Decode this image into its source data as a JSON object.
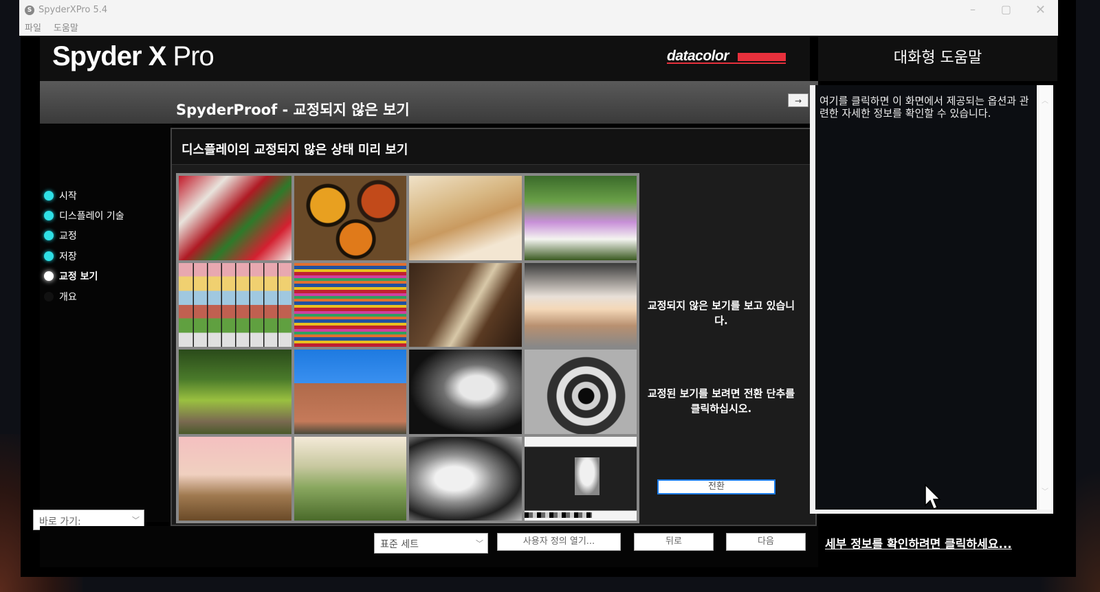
{
  "window": {
    "title": "SpyderXPro 5.4",
    "icon_glyph": "S",
    "menu": [
      "파일",
      "도움말"
    ]
  },
  "header": {
    "logo_bold": "Spyder X",
    "logo_light": " Pro",
    "brand": "datacolor",
    "help_title": "대화형 도움말"
  },
  "section": {
    "title": "SpyderProof - 교정되지 않은 보기",
    "collapse_glyph": "→"
  },
  "nav": {
    "items": [
      {
        "label": "시작",
        "state": "done"
      },
      {
        "label": "디스플레이 기술",
        "state": "done"
      },
      {
        "label": "교정",
        "state": "done"
      },
      {
        "label": "저장",
        "state": "done"
      },
      {
        "label": "교정 보기",
        "state": "active"
      },
      {
        "label": "개요",
        "state": "pending"
      }
    ],
    "goto_label": "바로 가기:"
  },
  "content": {
    "title": "디스플레이의 교정되지 않은 상태 미리 보기",
    "tile_icons": [
      "peppers-image",
      "pottery-image",
      "portrait-woman-image",
      "girl-flowers-image",
      "colorchecker-image",
      "textiles-image",
      "guitarist-image",
      "street-performer-image",
      "garden-urn-image",
      "church-image",
      "bw-portrait-image",
      "spiral-stairs-image",
      "sunset-field-image",
      "tuscany-hills-image",
      "scooter-image",
      "bw-test-chart-image"
    ],
    "message_1": "교정되지 않은 보기를 보고 있습니다.",
    "message_2": "교정된 보기를 보려면 전환 단추를 클릭하십시오.",
    "switch_label": "전환"
  },
  "footer": {
    "preset_value": "표준 세트",
    "custom_open_label": "사용자 정의 열기...",
    "back_label": "뒤로",
    "next_label": "다음"
  },
  "help": {
    "body": "여기를 클릭하면 이 화면에서 제공되는 옵션과 관련한 자세한 정보를 확인할 수 있습니다.",
    "details_link": "세부 정보를 확인하려면 클릭하세요..."
  },
  "colors": {
    "accent_cyan": "#2fe0e6",
    "brand_red": "#e8303c",
    "switch_border": "#1a7ae8"
  }
}
